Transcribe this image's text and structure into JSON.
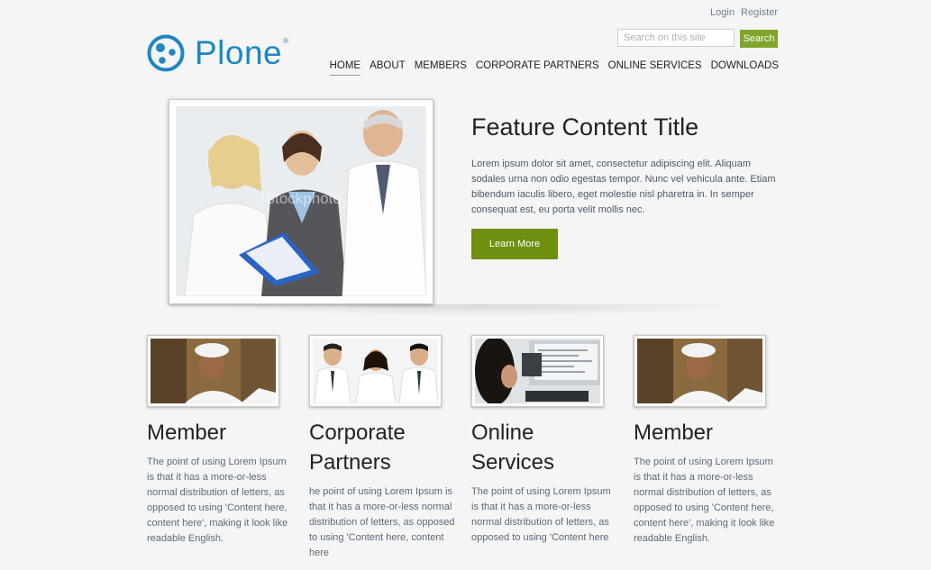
{
  "header": {
    "login_label": "Login",
    "register_label": "Register",
    "logo_text": "Plone",
    "logo_reg": "®",
    "search_placeholder": "Search on this site",
    "search_button": "Search"
  },
  "nav": {
    "items": [
      "HOME",
      "ABOUT",
      "MEMBERS",
      "CORPORATE PARTNERS",
      "ONLINE SERVICES",
      "DOWNLOADS"
    ],
    "active": "HOME"
  },
  "feature": {
    "title": "Feature Content Title",
    "body": "Lorem ipsum dolor sit amet, consectetur adipiscing elit. Aliquam sodales urna non odio egestas tempor. Nunc vel vehicula ante. Etiam bibendum iaculis libero, eget molestie nisl pharetra in. In semper consequat est, eu porta velit mollis nec.",
    "button": "Learn More",
    "watermark": "iStockphoto"
  },
  "cards": [
    {
      "title": "Member",
      "text": "The point of using Lorem Ipsum is that it has a more-or-less normal distribution of letters, as opposed to using 'Content here, content here', making it look like readable English."
    },
    {
      "title": "Corporate Partners",
      "text": "he point of using Lorem Ipsum is that it has a more-or-less normal distribution of letters, as opposed to using 'Content here, content here"
    },
    {
      "title": "Online Services",
      "text": "The point of using Lorem Ipsum is that it has a more-or-less normal distribution of letters, as opposed to using 'Content here"
    },
    {
      "title": "Member",
      "text": "The point of using Lorem Ipsum is that it has a more-or-less normal distribution of letters, as opposed to using 'Content here, content here', making it look like readable English."
    }
  ],
  "colors": {
    "brand_blue": "#1e87c3",
    "search_green": "#7fa52a",
    "button_green": "#6f8f0e",
    "background": "#f5f5f5"
  }
}
